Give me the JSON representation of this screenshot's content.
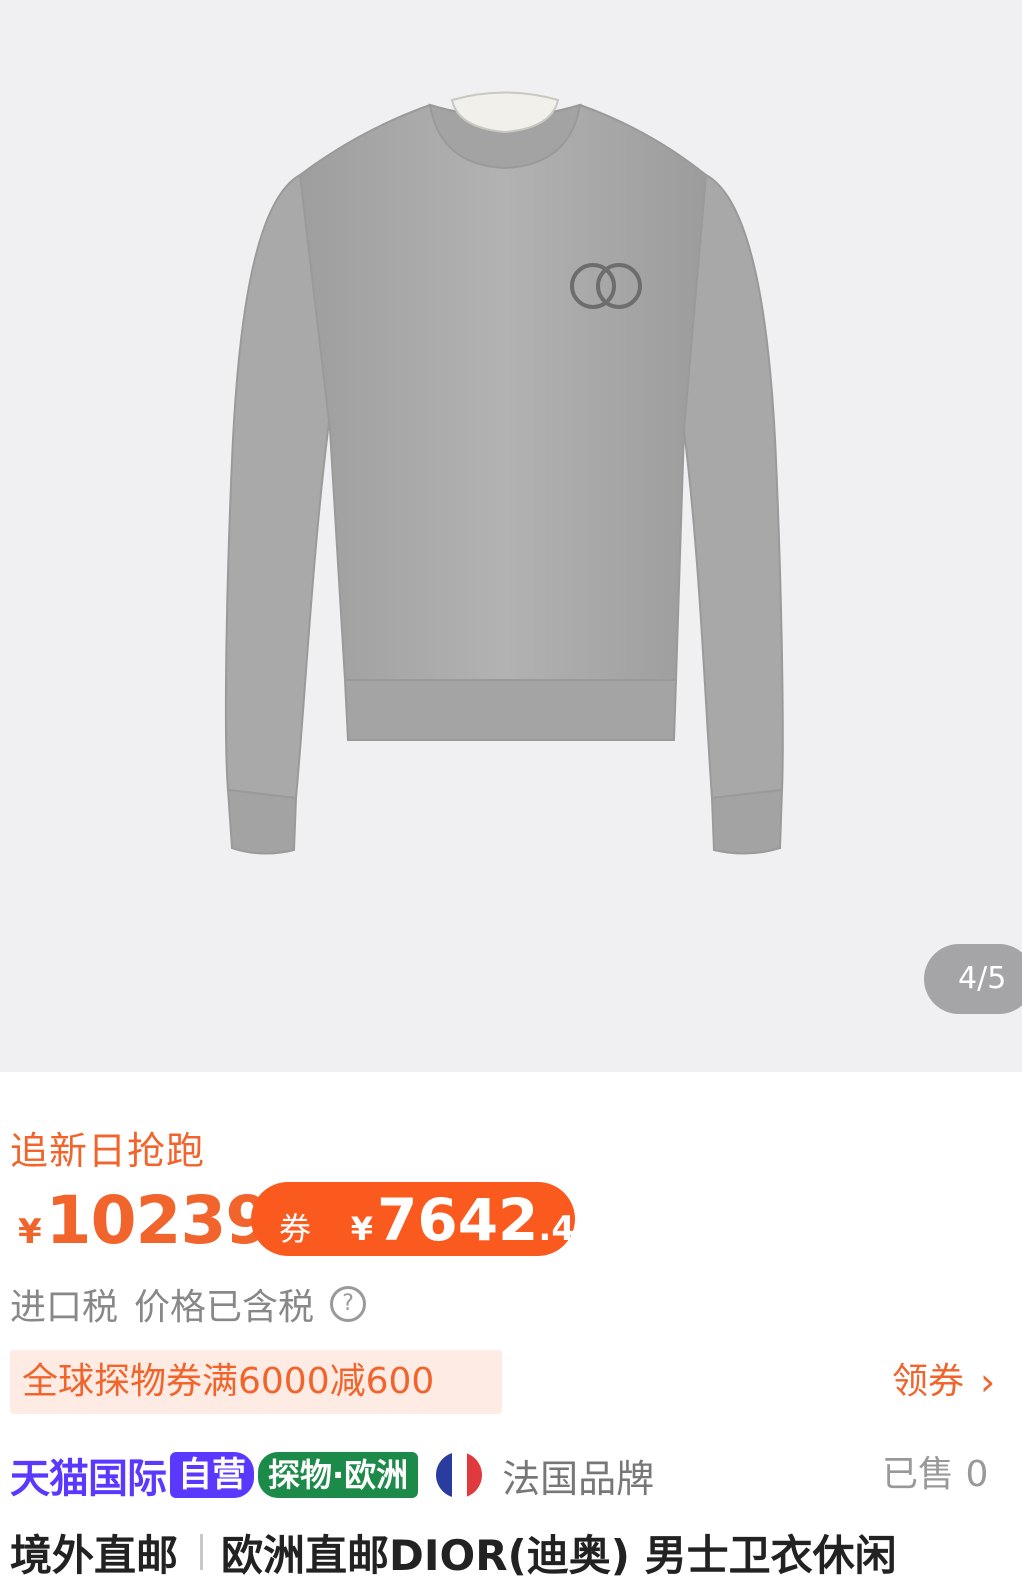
{
  "gallery": {
    "image_alt": "grey crewneck sweatshirt with CD logo",
    "page_indicator": "4/5"
  },
  "promo": {
    "title": "追新日抢跑"
  },
  "price": {
    "currency": "¥",
    "value": "10239",
    "coupon_label": "券后",
    "coupon_currency": "¥",
    "coupon_integer": "7642",
    "coupon_decimal": ".4"
  },
  "tax": {
    "label": "进口税",
    "note": "价格已含税",
    "help_icon": "?"
  },
  "coupon": {
    "text": "全球探物券满6000减600",
    "action": "领券",
    "chevron": "›"
  },
  "badges": {
    "platform": "天猫国际",
    "self_operated": "自营",
    "explore": "探物·欧洲",
    "flag_icon": "france-flag-icon",
    "origin": "法国品牌",
    "sold": "已售 0"
  },
  "product": {
    "shipping_tag": "境外直邮",
    "title": "欧洲直邮DIOR(迪奥) 男士卫衣休闲"
  },
  "colors": {
    "accent": "#f1642c",
    "coupon_pill": "#fb5a1f",
    "tmall_purple": "#5b38ff",
    "explore_green": "#1c8a48"
  }
}
